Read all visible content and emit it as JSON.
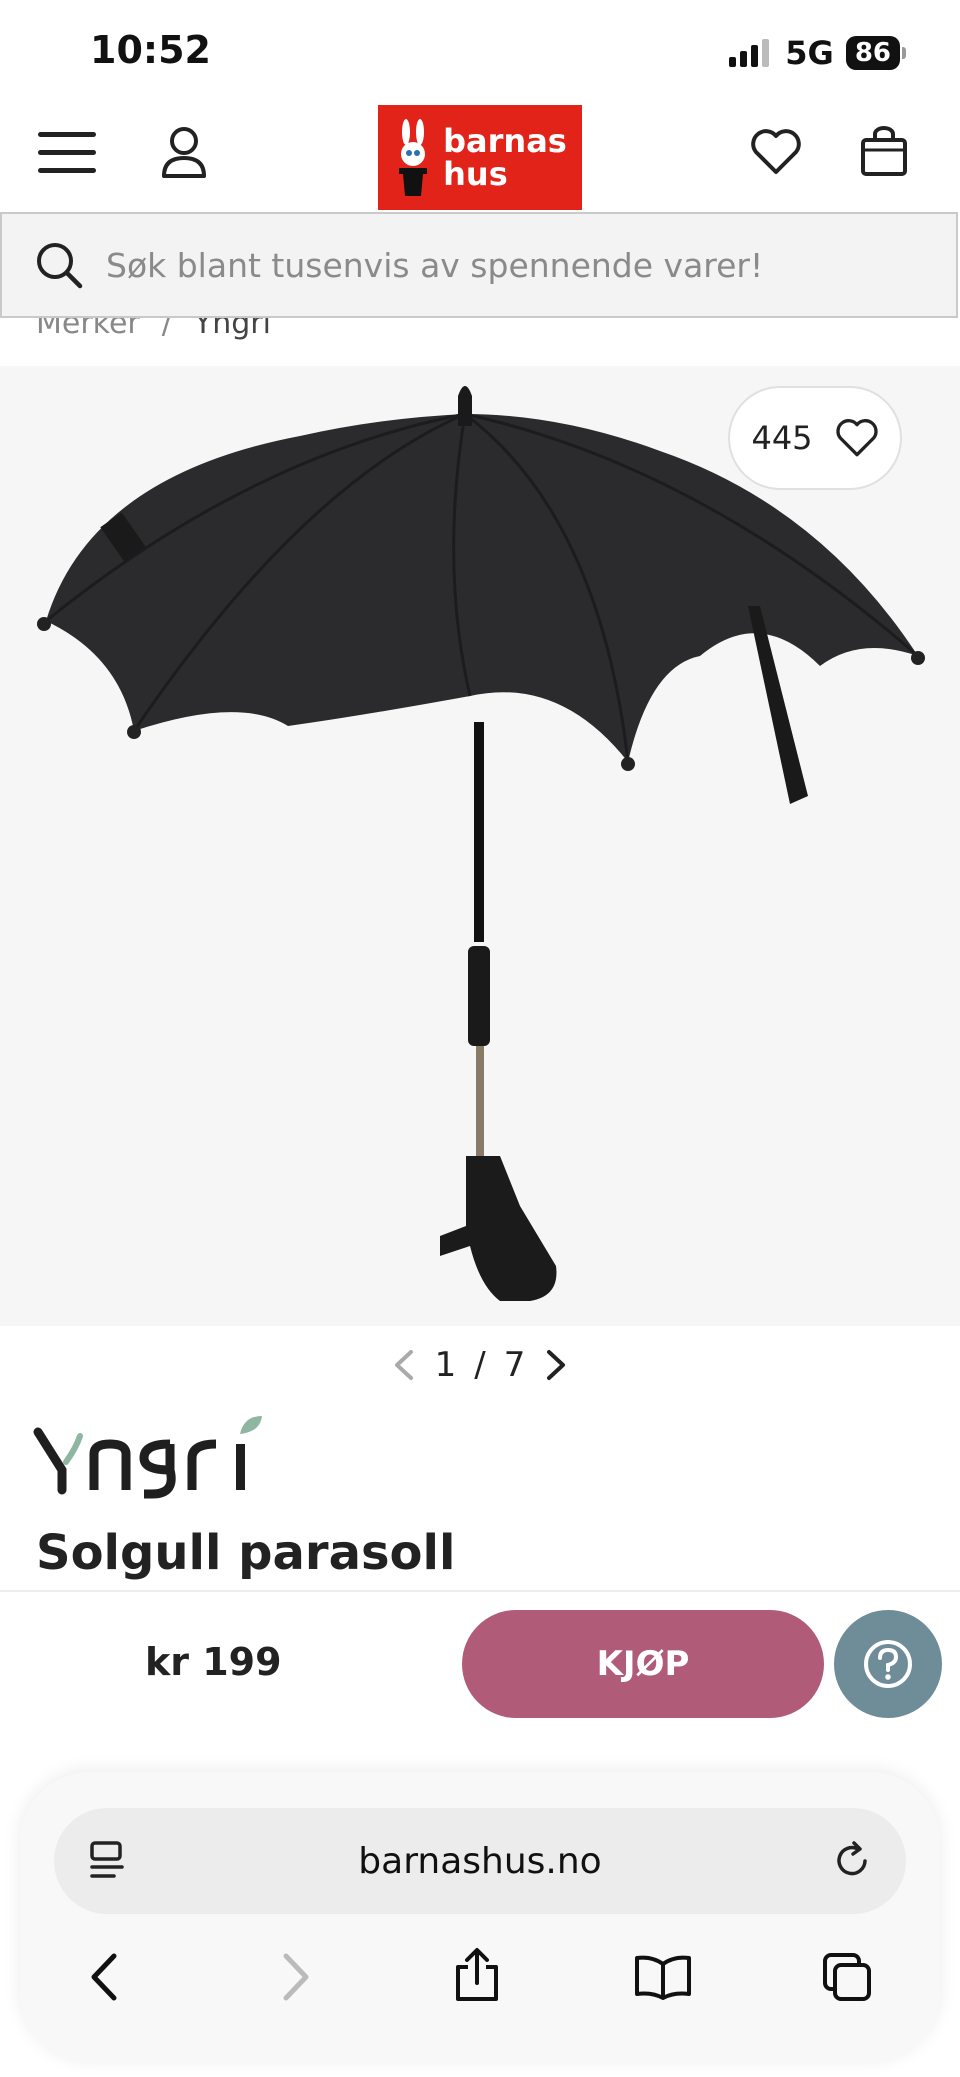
{
  "status": {
    "time": "10:52",
    "network": "5G",
    "battery": "86"
  },
  "header": {
    "logo_line1": "barnas",
    "logo_line2": "hus"
  },
  "search": {
    "placeholder": "Søk blant tusenvis av spennende varer!"
  },
  "breadcrumb": {
    "items": [
      "Merker",
      "Yngri"
    ],
    "separator": "/"
  },
  "product": {
    "wishlist_count": "445",
    "image_index": "1",
    "image_total": "7",
    "brand": "Yngri",
    "name": "Solgull parasoll",
    "price": "kr 199",
    "buy_label": "KJØP"
  },
  "browser": {
    "url": "barnashus.no"
  },
  "colors": {
    "logo_red": "#e2231a",
    "buy_button": "#b05b77",
    "help_button": "#6f8c99"
  }
}
